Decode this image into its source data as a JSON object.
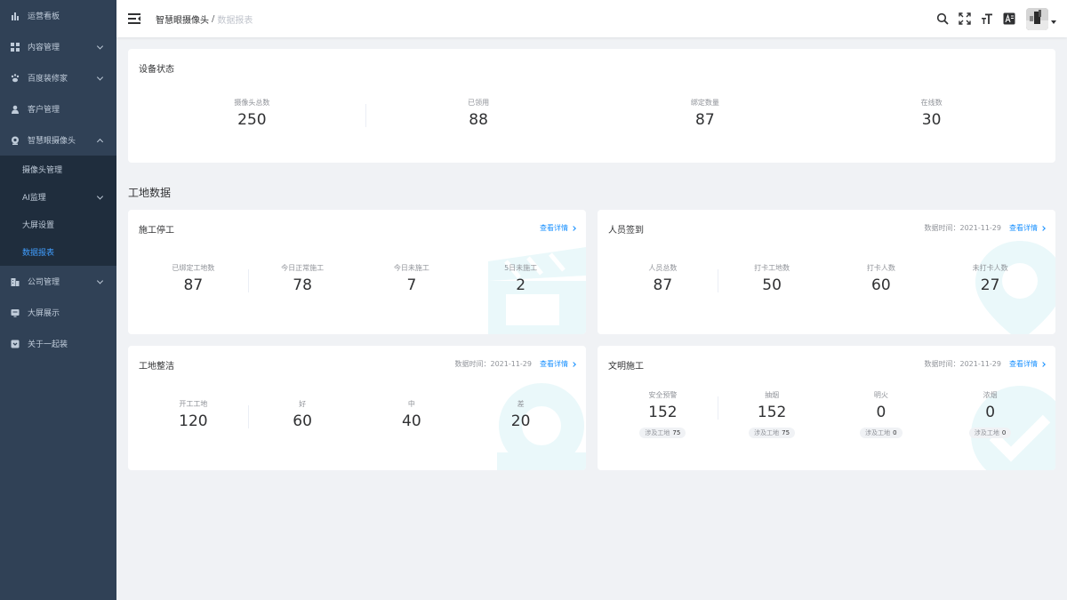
{
  "sidebar": {
    "items": [
      {
        "label": "运营看板",
        "icon": "bar-chart-icon"
      },
      {
        "label": "内容管理",
        "icon": "grid-icon"
      },
      {
        "label": "百度装修家",
        "icon": "paw-icon"
      },
      {
        "label": "客户管理",
        "icon": "user-icon"
      },
      {
        "label": "智慧眼摄像头",
        "icon": "camera-icon"
      },
      {
        "label": "公司管理",
        "icon": "building-icon"
      },
      {
        "label": "大屏展示",
        "icon": "screen-icon"
      },
      {
        "label": "关于一起装",
        "icon": "info-icon"
      }
    ],
    "submenu": [
      {
        "label": "摄像头管理"
      },
      {
        "label": "AI监理"
      },
      {
        "label": "大屏设置"
      },
      {
        "label": "数据报表"
      }
    ],
    "colors": {
      "bg": "#304156",
      "submenu_bg": "#1f2d3d",
      "text": "#bfcbd9",
      "active": "#409eff"
    }
  },
  "header": {
    "breadcrumb": [
      "智慧眼摄像头",
      "数据报表"
    ],
    "breadcrumb_sep": "/",
    "icons": [
      "search-icon",
      "fullscreen-icon",
      "font-size-icon",
      "translate-icon"
    ]
  },
  "device_status": {
    "title": "设备状态",
    "stats": [
      {
        "label": "摄像头总数",
        "value": "250"
      },
      {
        "label": "已领用",
        "value": "88"
      },
      {
        "label": "绑定数量",
        "value": "87"
      },
      {
        "label": "在线数",
        "value": "30"
      }
    ]
  },
  "section_title": "工地数据",
  "construction_stop": {
    "title": "施工停工",
    "link": "查看详情",
    "stats": [
      {
        "label": "已绑定工地数",
        "value": "87"
      },
      {
        "label": "今日正常施工",
        "value": "78"
      },
      {
        "label": "今日未施工",
        "value": "7"
      },
      {
        "label": "5日未施工",
        "value": "2"
      }
    ]
  },
  "staff_signin": {
    "title": "人员签到",
    "date": "数据时间：2021-11-29",
    "link": "查看详情",
    "stats": [
      {
        "label": "人员总数",
        "value": "87"
      },
      {
        "label": "打卡工地数",
        "value": "50"
      },
      {
        "label": "打卡人数",
        "value": "60"
      },
      {
        "label": "未打卡人数",
        "value": "27"
      }
    ]
  },
  "site_clean": {
    "title": "工地整洁",
    "date": "数据时间：2021-11-29",
    "link": "查看详情",
    "stats": [
      {
        "label": "开工工地",
        "value": "120"
      },
      {
        "label": "好",
        "value": "60"
      },
      {
        "label": "中",
        "value": "40"
      },
      {
        "label": "差",
        "value": "20"
      }
    ]
  },
  "civil_construction": {
    "title": "文明施工",
    "date": "数据时间：2021-11-29",
    "link": "查看详情",
    "pill_label": "涉及工地",
    "stats": [
      {
        "label": "安全预警",
        "value": "152",
        "sites": "75"
      },
      {
        "label": "抽烟",
        "value": "152",
        "sites": "75"
      },
      {
        "label": "明火",
        "value": "0",
        "sites": "0"
      },
      {
        "label": "浓烟",
        "value": "0",
        "sites": "0"
      }
    ]
  },
  "theme": {
    "accent": "#1890ff",
    "deco": "#e8f7fa"
  }
}
